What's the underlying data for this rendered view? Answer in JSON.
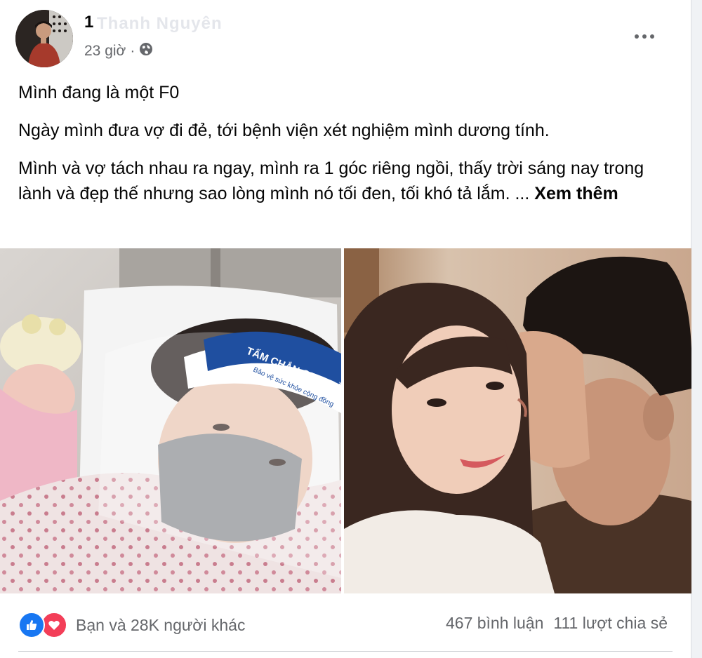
{
  "post": {
    "author": "1",
    "author_blurred": "Thanh Nguyên",
    "time": "23 giờ",
    "separator": "·",
    "privacy_icon": "globe-icon",
    "more_icon": "more-horizontal-icon",
    "paragraphs": [
      "Mình đang là một F0",
      "Ngày mình đưa vợ đi đẻ, tới bệnh viện xét nghiệm mình dương tính.",
      "Mình và vợ tách nhau ra ngay, mình ra 1 góc riêng ngồi, thấy trời sáng nay trong lành và đẹp thế nhưng sao lòng mình nó tối đen, tối khó tả lắm. ..."
    ],
    "see_more": "Xem thêm",
    "face_shield_text": "TẤM CHẮN GIỌT BẮN",
    "face_shield_subtext": "Bảo vệ sức khỏe cộng đồng"
  },
  "footer": {
    "reaction_icons": [
      "like-icon",
      "love-icon"
    ],
    "reactions_text": "Bạn và 28K người khác",
    "comments": "467 bình luận",
    "shares": "111 lượt chia sẻ"
  },
  "colors": {
    "like": "#1877f2",
    "love": "#f33e58",
    "secondary_text": "#65676b"
  }
}
